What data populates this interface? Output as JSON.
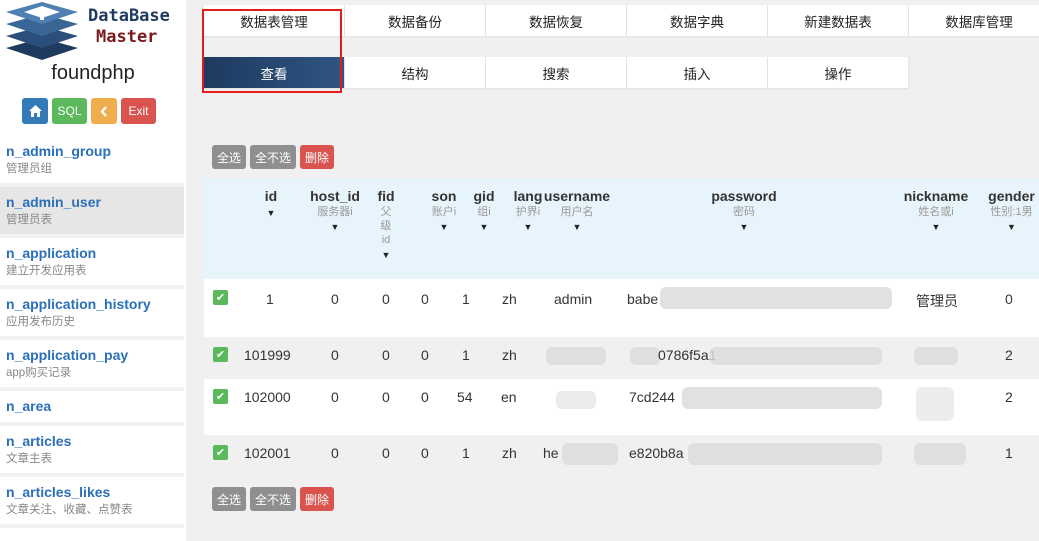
{
  "logo": {
    "line1": "DataBase",
    "line2": "Master"
  },
  "site_name": "foundphp",
  "quick_buttons": {
    "sql": "SQL",
    "exit": "Exit"
  },
  "tables": [
    {
      "name": "n_admin_group",
      "desc": "管理员组"
    },
    {
      "name": "n_admin_user",
      "desc": "管理员表"
    },
    {
      "name": "n_application",
      "desc": "建立开发应用表"
    },
    {
      "name": "n_application_history",
      "desc": "应用发布历史"
    },
    {
      "name": "n_application_pay",
      "desc": "app购买记录"
    },
    {
      "name": "n_area",
      "desc": ""
    },
    {
      "name": "n_articles",
      "desc": "文章主表"
    },
    {
      "name": "n_articles_likes",
      "desc": "文章关注、收藏、点赞表"
    }
  ],
  "nav_top": [
    "数据表管理",
    "数据备份",
    "数据恢复",
    "数据字典",
    "新建数据表",
    "数据库管理"
  ],
  "nav_sub": [
    "查看",
    "结构",
    "搜索",
    "插入",
    "操作"
  ],
  "actions": {
    "select_all": "全选",
    "select_none": "全不选",
    "delete": "删除"
  },
  "columns": [
    {
      "name": "id",
      "comment": ""
    },
    {
      "name": "host_id",
      "comment": "服务器i"
    },
    {
      "name": "fid",
      "comment": "父级id"
    },
    {
      "name": "son",
      "comment": "账户i"
    },
    {
      "name": "gid",
      "comment": "组i"
    },
    {
      "name": "lang",
      "comment": "护界i"
    },
    {
      "name": "username",
      "comment": "用户名"
    },
    {
      "name": "password",
      "comment": "密码"
    },
    {
      "name": "nickname",
      "comment": "姓名或i"
    },
    {
      "name": "gender",
      "comment": "性别:1男"
    }
  ],
  "rows": [
    {
      "id": "1",
      "host_id": "0",
      "fid": "0",
      "son": "0",
      "gid": "1",
      "lang": "zh",
      "username": "admin",
      "password": "babe",
      "nickname": "管理员",
      "gender": "0"
    },
    {
      "id": "101999",
      "host_id": "0",
      "fid": "0",
      "son": "0",
      "gid": "1",
      "lang": "zh",
      "username": "",
      "password": "0786f5a1",
      "nickname": "",
      "gender": "2"
    },
    {
      "id": "102000",
      "host_id": "0",
      "fid": "0",
      "son": "0",
      "gid": "54",
      "lang": "en",
      "username": "",
      "password": "7cd244",
      "nickname": "",
      "gender": "2"
    },
    {
      "id": "102001",
      "host_id": "0",
      "fid": "0",
      "son": "0",
      "gid": "1",
      "lang": "zh",
      "username": "he",
      "password": "e820b8a",
      "nickname": "",
      "gender": "1"
    }
  ],
  "colors": {
    "primary": "#1e3a5f",
    "highlight": "#e21b1b",
    "link": "#2a6fb8"
  }
}
